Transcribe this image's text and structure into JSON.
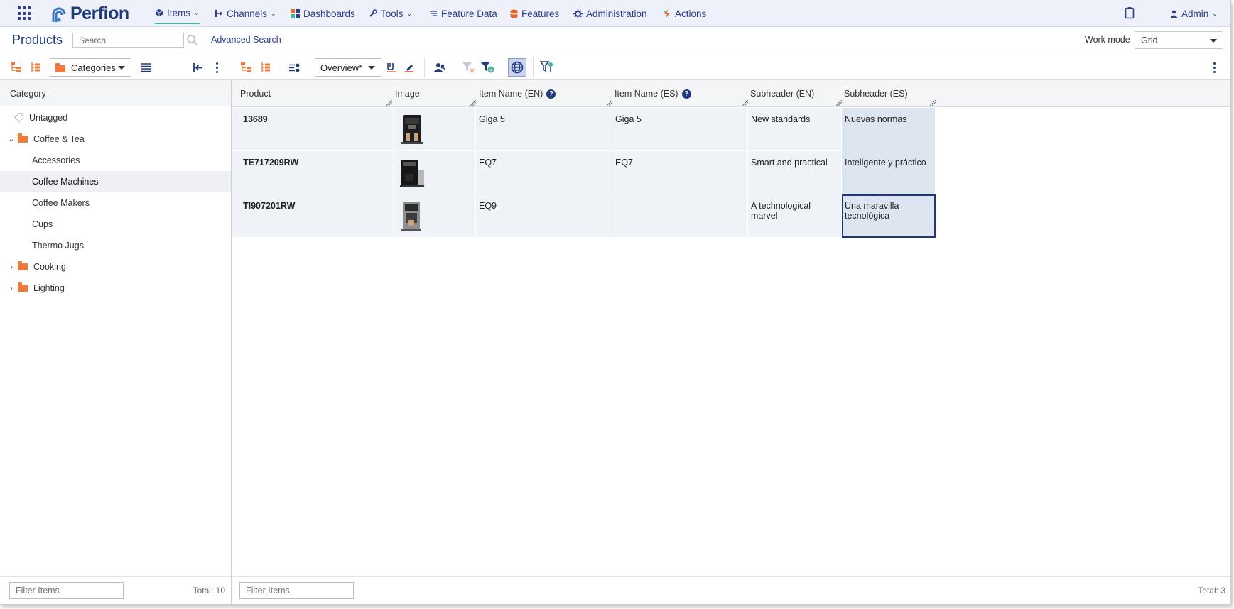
{
  "app": {
    "logo_text": "Perfion",
    "nav": [
      {
        "label": "Items",
        "icon": "cube-icon",
        "has_dropdown": true,
        "active": true
      },
      {
        "label": "Channels",
        "icon": "channels-icon",
        "has_dropdown": true
      },
      {
        "label": "Dashboards",
        "icon": "dashboard-icon",
        "has_dropdown": false
      },
      {
        "label": "Tools",
        "icon": "wrench-icon",
        "has_dropdown": true
      },
      {
        "label": "Feature Data",
        "icon": "list-icon",
        "has_dropdown": false
      },
      {
        "label": "Features",
        "icon": "database-icon",
        "has_dropdown": false
      },
      {
        "label": "Administration",
        "icon": "gear-icon",
        "has_dropdown": false
      },
      {
        "label": "Actions",
        "icon": "lightning-icon",
        "has_dropdown": false
      }
    ],
    "user": "Admin",
    "accent": "#2d3e8b",
    "active_underline": "#4ab39b",
    "folder_color": "#ef7a3d"
  },
  "subheader": {
    "title": "Products",
    "search_placeholder": "Search",
    "advanced_search": "Advanced Search",
    "workmode_label": "Work mode",
    "workmode_value": "Grid"
  },
  "toolbar": {
    "categories_dropdown": "Categories",
    "view_dropdown": "Overview*"
  },
  "category_panel": {
    "header": "Category",
    "tree": [
      {
        "label": "Untagged",
        "level": 0,
        "type": "tag"
      },
      {
        "label": "Coffee & Tea",
        "level": 0,
        "type": "folder",
        "expanded": true
      },
      {
        "label": "Accessories",
        "level": 1
      },
      {
        "label": "Coffee Machines",
        "level": 1,
        "selected": true
      },
      {
        "label": "Coffee Makers",
        "level": 1
      },
      {
        "label": "Cups",
        "level": 1
      },
      {
        "label": "Thermo Jugs",
        "level": 1
      },
      {
        "label": "Cooking",
        "level": 0,
        "type": "folder",
        "expanded": false
      },
      {
        "label": "Lighting",
        "level": 0,
        "type": "folder",
        "expanded": false
      }
    ],
    "filter_placeholder": "Filter Items",
    "total": "Total: 10"
  },
  "grid": {
    "columns": [
      "Product",
      "Image",
      "Item Name (EN)",
      "Item Name (ES)",
      "Subheader (EN)",
      "Subheader (ES)"
    ],
    "rows": [
      {
        "product": "13689",
        "item_en": "Giga 5",
        "item_es": "Giga 5",
        "sub_en": "New standards",
        "sub_es": "Nuevas normas"
      },
      {
        "product": "TE717209RW",
        "item_en": "EQ7",
        "item_es": "EQ7",
        "sub_en": "Smart and practical",
        "sub_es": "Inteligente y práctico"
      },
      {
        "product": "TI907201RW",
        "item_en": "EQ9",
        "item_es": "",
        "sub_en": "A technological marvel",
        "sub_es": "Una maravilla tecnológica"
      }
    ],
    "filter_placeholder": "Filter Items",
    "total": "Total: 3"
  }
}
